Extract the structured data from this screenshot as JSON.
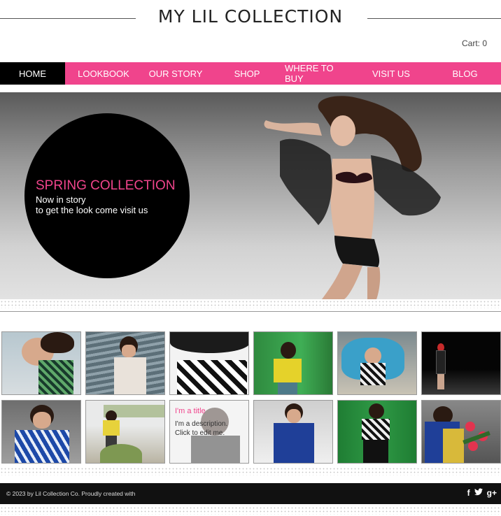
{
  "site": {
    "title": "MY LIL COLLECTION",
    "cart": "Cart: 0"
  },
  "nav": {
    "items": [
      "HOME",
      "LOOKBOOK",
      "OUR STORY",
      "SHOP",
      "WHERE TO BUY",
      "VISIT US",
      "BLOG"
    ],
    "active": "HOME"
  },
  "hero": {
    "title": "SPRING COLLECTION",
    "line1": "Now in story",
    "line2": "to get the look come visit us"
  },
  "gallery": {
    "overlay_title": "I'm a title",
    "overlay_desc_1": "I'm a description.",
    "overlay_desc_2": "Click to edit me."
  },
  "footer": {
    "copyright": "© 2023 by Lil Collection Co. Proudly created with"
  },
  "social": {
    "facebook": "f",
    "twitter": "t",
    "google": "g+"
  },
  "colors": {
    "accent": "#f0448c",
    "nav_active": "#000000",
    "footer": "#111111"
  }
}
